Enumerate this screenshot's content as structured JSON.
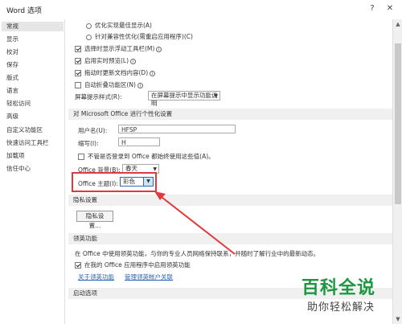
{
  "window": {
    "title": "Word 选项",
    "help_glyph": "?",
    "close_glyph": "✕"
  },
  "sidebar": {
    "items": [
      {
        "label": "常规"
      },
      {
        "label": "显示"
      },
      {
        "label": "校对"
      },
      {
        "label": "保存"
      },
      {
        "label": "版式"
      },
      {
        "label": "语言"
      },
      {
        "label": "轻松访问"
      },
      {
        "label": "高级"
      },
      {
        "label": "自定义功能区"
      },
      {
        "label": "快速访问工具栏"
      },
      {
        "label": "加载项"
      },
      {
        "label": "信任中心"
      }
    ],
    "active_index": 0
  },
  "general": {
    "radio_optimize_display": "优化实现最佳显示(A)",
    "radio_optimize_compat": "针对兼容性优化(需重启应用程序)(C)",
    "show_mini_toolbar": "选择时显示浮动工具栏(M)",
    "enable_live_preview": "启用实时预览(L)",
    "update_on_drag": "拖动时更新文档内容(D)",
    "auto_collapse_ribbon": "自动折叠功能区(N)",
    "screentip_label": "屏幕提示样式(R):",
    "screentip_value": "在屏幕提示中显示功能说明"
  },
  "personalize": {
    "section_title": "对 Microsoft Office 进行个性化设置",
    "username_label": "用户名(U):",
    "username_value": "HFSP",
    "initials_label": "缩写(I):",
    "initials_value": "H",
    "always_use_label": "不管是否登录到 Office 都始终使用这些值(A)。",
    "background_label": "Office 背景(B):",
    "background_value": "春天",
    "theme_label": "Office 主题(I):",
    "theme_value": "彩色"
  },
  "privacy": {
    "section_title": "隐私设置",
    "button_label": "隐私设置..."
  },
  "linkedin": {
    "section_title": "领英功能",
    "description": "在 Office 中使用领英功能，与你的专业人员网络保持联系，并随时了解行业中的最新动态。",
    "enable_label": "在我的 Office 应用程序中启用领英功能",
    "link_about": "关于领英功能",
    "link_manage": "管理领英帐户关联"
  },
  "startup": {
    "section_title": "启动选项"
  },
  "watermark": {
    "main": "百科全说",
    "sub": "助你轻松解决"
  },
  "colors": {
    "annotation_red": "#e03a3a",
    "watermark_green": "#1d9640",
    "link_blue": "#2b62b7"
  }
}
